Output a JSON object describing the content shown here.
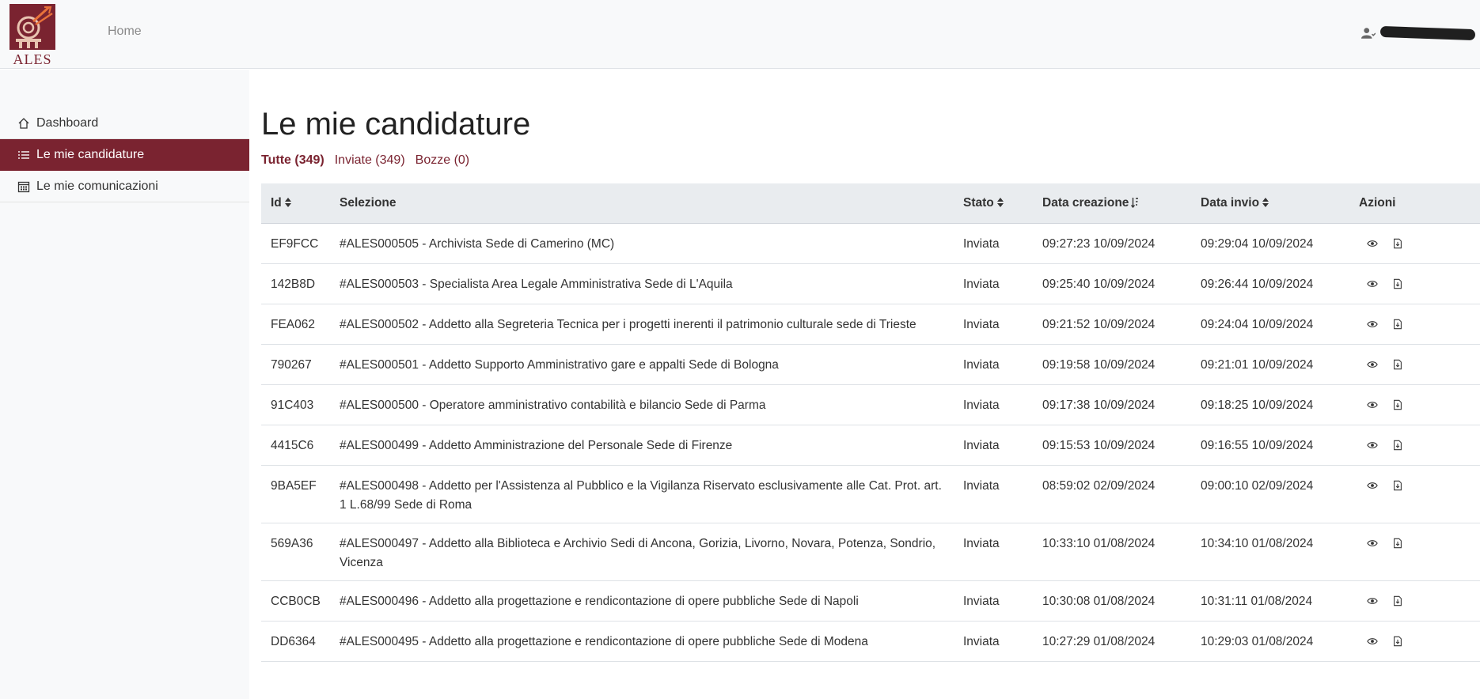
{
  "header": {
    "logo_text": "ALES",
    "nav_home": "Home"
  },
  "sidebar": {
    "items": [
      {
        "label": "Dashboard",
        "icon": "house-icon",
        "active": false
      },
      {
        "label": "Le mie candidature",
        "icon": "list-icon",
        "active": true
      },
      {
        "label": "Le mie comunicazioni",
        "icon": "calendar-icon",
        "active": false
      }
    ]
  },
  "main": {
    "title": "Le mie candidature",
    "filters": [
      {
        "label": "Tutte (349)",
        "active": true
      },
      {
        "label": "Inviate (349)",
        "active": false
      },
      {
        "label": "Bozze (0)",
        "active": false
      }
    ],
    "table": {
      "columns": [
        "Id",
        "Selezione",
        "Stato",
        "Data creazione",
        "Data invio",
        "Azioni"
      ],
      "rows": [
        {
          "id": "EF9FCC",
          "selezione": "#ALES000505 - Archivista Sede di Camerino (MC)",
          "stato": "Inviata",
          "creazione": "09:27:23 10/09/2024",
          "invio": "09:29:04 10/09/2024"
        },
        {
          "id": "142B8D",
          "selezione": "#ALES000503 - Specialista Area Legale Amministrativa Sede di L'Aquila",
          "stato": "Inviata",
          "creazione": "09:25:40 10/09/2024",
          "invio": "09:26:44 10/09/2024"
        },
        {
          "id": "FEA062",
          "selezione": "#ALES000502 - Addetto alla Segreteria Tecnica per i progetti inerenti il patrimonio culturale sede di Trieste",
          "stato": "Inviata",
          "creazione": "09:21:52 10/09/2024",
          "invio": "09:24:04 10/09/2024"
        },
        {
          "id": "790267",
          "selezione": "#ALES000501 - Addetto Supporto Amministrativo gare e appalti Sede di Bologna",
          "stato": "Inviata",
          "creazione": "09:19:58 10/09/2024",
          "invio": "09:21:01 10/09/2024"
        },
        {
          "id": "91C403",
          "selezione": "#ALES000500 - Operatore amministrativo contabilità e bilancio Sede di Parma",
          "stato": "Inviata",
          "creazione": "09:17:38 10/09/2024",
          "invio": "09:18:25 10/09/2024"
        },
        {
          "id": "4415C6",
          "selezione": "#ALES000499 - Addetto Amministrazione del Personale Sede di Firenze",
          "stato": "Inviata",
          "creazione": "09:15:53 10/09/2024",
          "invio": "09:16:55 10/09/2024"
        },
        {
          "id": "9BA5EF",
          "selezione": "#ALES000498 - Addetto per l'Assistenza al Pubblico e la Vigilanza Riservato esclusivamente alle Cat. Prot. art. 1 L.68/99 Sede di Roma",
          "stato": "Inviata",
          "creazione": "08:59:02 02/09/2024",
          "invio": "09:00:10 02/09/2024"
        },
        {
          "id": "569A36",
          "selezione": "#ALES000497 - Addetto alla Biblioteca e Archivio Sedi di Ancona, Gorizia, Livorno, Novara, Potenza, Sondrio, Vicenza",
          "stato": "Inviata",
          "creazione": "10:33:10 01/08/2024",
          "invio": "10:34:10 01/08/2024"
        },
        {
          "id": "CCB0CB",
          "selezione": "#ALES000496 - Addetto alla progettazione e rendicontazione di opere pubbliche Sede di Napoli",
          "stato": "Inviata",
          "creazione": "10:30:08 01/08/2024",
          "invio": "10:31:11 01/08/2024"
        },
        {
          "id": "DD6364",
          "selezione": "#ALES000495 - Addetto alla progettazione e rendicontazione di opere pubbliche Sede di Modena",
          "stato": "Inviata",
          "creazione": "10:27:29 01/08/2024",
          "invio": "10:29:03 01/08/2024"
        }
      ]
    }
  },
  "colors": {
    "brand": "#7a2330",
    "header_bg": "#f8f9fa",
    "table_head_bg": "#e9ecef"
  }
}
